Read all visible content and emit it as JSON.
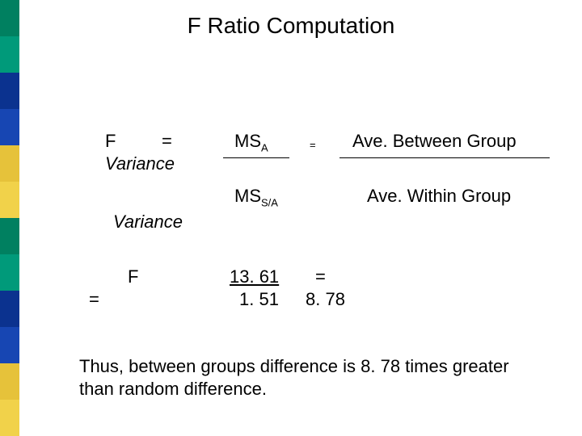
{
  "title": "F Ratio Computation",
  "line1": {
    "F": "F",
    "eq1": "=",
    "ms": "MS",
    "subA": "A",
    "smalleq": "=",
    "between": "Ave. Between Group"
  },
  "variance_top": "Variance",
  "line2": {
    "ms": "MS",
    "subSA": "S/A",
    "within": "Ave. Within Group"
  },
  "variance_bottom": "Variance",
  "calc": {
    "F": "F",
    "num": "13. 61",
    "eq": "=",
    "den": "1. 51",
    "res": "8. 78"
  },
  "eqsign": "=",
  "conclusion": "Thus, between groups difference is 8. 78 times greater\nthan random difference.",
  "chart_data": {
    "type": "table",
    "title": "F Ratio Computation",
    "formula": "F = MS_A / MS_{S/A} = Ave. Between Group Variance / Ave. Within Group Variance",
    "MS_A": 13.61,
    "MS_S_over_A": 1.51,
    "F": 8.78,
    "interpretation": "Between groups difference is 8.78 times greater than random difference."
  }
}
